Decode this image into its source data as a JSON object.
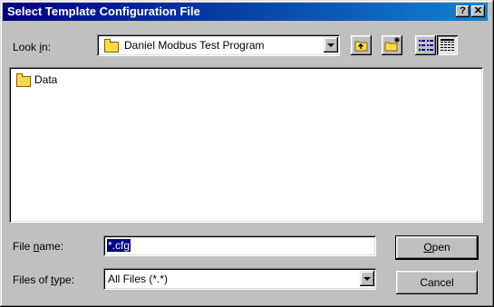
{
  "dialog": {
    "title": "Select Template Configuration File",
    "help_button": "?",
    "close_button": "✕"
  },
  "look_in": {
    "label_pre": "Look ",
    "label_access": "i",
    "label_post": "n:",
    "value": "Daniel Modbus Test Program"
  },
  "toolbar": {
    "up_one_level_icon": "up-folder-icon",
    "create_new_folder_icon": "new-folder-icon",
    "list_view_icon": "list-view-icon",
    "details_view_icon": "details-view-icon"
  },
  "file_list": {
    "items": [
      {
        "name": "Data",
        "icon": "folder-icon"
      }
    ]
  },
  "file_name": {
    "label_pre": "File ",
    "label_access": "n",
    "label_post": "ame:",
    "value": "*.cfg"
  },
  "file_type": {
    "label_pre": "Files of ",
    "label_access": "t",
    "label_post": "ype:",
    "value": "All Files (*.*)"
  },
  "buttons": {
    "open_access": "O",
    "open_rest": "pen",
    "cancel": "Cancel"
  },
  "colors": {
    "title_start": "#000080",
    "title_end": "#1084d0",
    "face": "#c0c0c0",
    "selection": "#000080"
  }
}
